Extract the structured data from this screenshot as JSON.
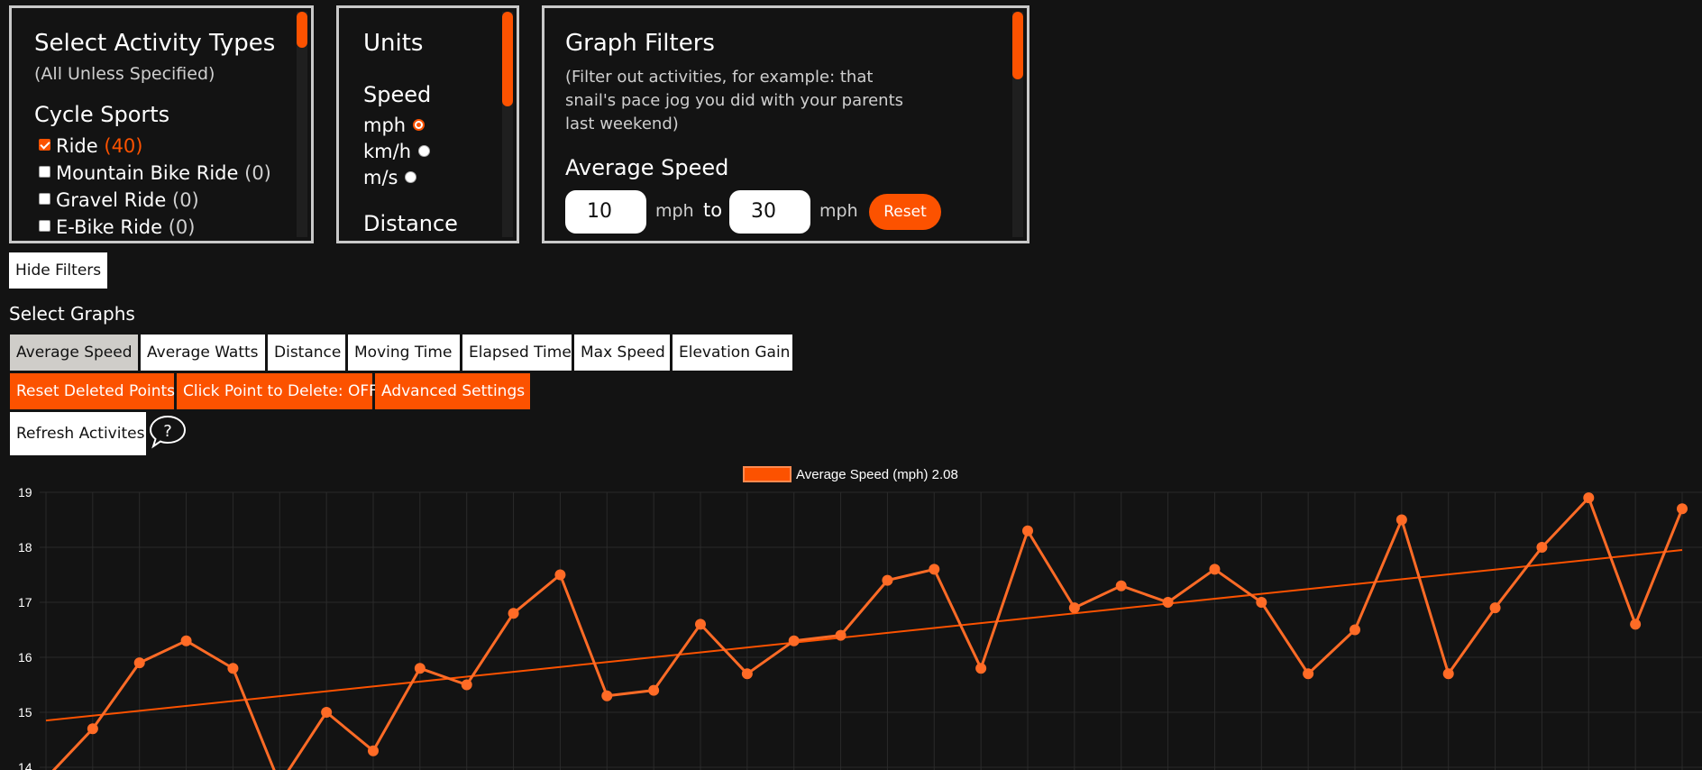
{
  "activity_panel": {
    "title": "Select Activity Types",
    "subtitle": "(All Unless Specified)",
    "section": "Cycle Sports",
    "items": [
      {
        "label": "Ride",
        "count": "(40)",
        "checked": true
      },
      {
        "label": "Mountain Bike Ride",
        "count": "(0)",
        "checked": false
      },
      {
        "label": "Gravel Ride",
        "count": "(0)",
        "checked": false
      },
      {
        "label": "E-Bike Ride",
        "count": "(0)",
        "checked": false
      }
    ]
  },
  "units_panel": {
    "title": "Units",
    "speed_heading": "Speed",
    "speed_options": [
      {
        "label": "mph",
        "selected": true
      },
      {
        "label": "km/h",
        "selected": false
      },
      {
        "label": "m/s",
        "selected": false
      }
    ],
    "distance_heading": "Distance"
  },
  "filters_panel": {
    "title": "Graph Filters",
    "description": "(Filter out activities, for example: that snail's pace jog you did with your parents last weekend)",
    "avg_speed_heading": "Average Speed",
    "min_value": "10",
    "max_value": "30",
    "unit": "mph",
    "to_label": "to",
    "reset_label": "Reset"
  },
  "hide_filters_label": "Hide Filters",
  "select_graphs_label": "Select Graphs",
  "graph_tabs": [
    "Average Speed",
    "Average Watts",
    "Distance",
    "Moving Time",
    "Elapsed Time",
    "Max Speed",
    "Elevation Gain"
  ],
  "action_buttons": {
    "reset_deleted": "Reset Deleted Points",
    "click_delete": "Click Point to Delete: OFF",
    "advanced": "Advanced Settings"
  },
  "refresh_label": "Refresh Activites",
  "help_icon": "speech-bubble-question-icon",
  "colors": {
    "accent": "#fc5200",
    "line": "#ff6b26",
    "background": "#131313"
  },
  "chart_data": {
    "type": "line",
    "legend": [
      {
        "name": "Average Speed (mph)",
        "value": "2.08"
      }
    ],
    "legend_position": "top-center",
    "y_ticks": [
      14,
      15,
      16,
      17,
      18,
      19
    ],
    "ylim": [
      14,
      19
    ],
    "grid": true,
    "series": [
      {
        "name": "Average Speed (mph)",
        "values": [
          13.8,
          14.7,
          15.9,
          16.3,
          15.8,
          13.7,
          15.0,
          14.3,
          15.8,
          15.5,
          16.8,
          17.5,
          15.3,
          15.4,
          16.6,
          15.7,
          16.3,
          16.4,
          17.4,
          17.6,
          15.8,
          18.3,
          16.9,
          17.3,
          17.0,
          17.6,
          17.0,
          15.7,
          16.5,
          18.5,
          15.7,
          16.9,
          18.0,
          18.9,
          16.6,
          18.7
        ]
      }
    ],
    "trendline": {
      "start": 14.85,
      "end": 17.95
    }
  }
}
